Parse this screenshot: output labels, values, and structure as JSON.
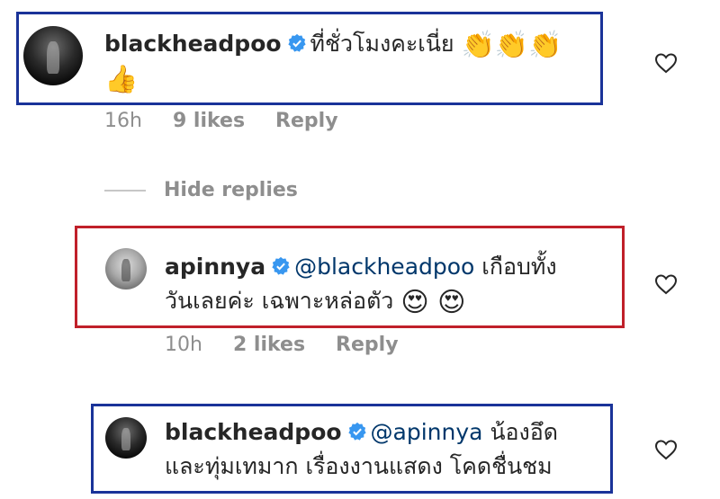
{
  "colors": {
    "frame_blue": "#1a3399",
    "frame_red": "#c0202a",
    "verified": "#3897f0",
    "mention": "#00376b",
    "meta": "#8e8e8e"
  },
  "comments": [
    {
      "username": "blackheadpoo",
      "text": "ที่ชั่วโมงคะเนี่ย",
      "emojis_line1": "👏👏👏",
      "emojis_line2": "👍",
      "time": "16h",
      "likes": "9 likes",
      "reply": "Reply"
    },
    {
      "username": "apinnya",
      "mention": "@blackheadpoo",
      "text_line1": "เกือบทั้ง",
      "text_line2": "วันเลยค่ะ เฉพาะหล่อตัว",
      "emojis": "😍 😍",
      "time": "10h",
      "likes": "2 likes",
      "reply": "Reply"
    },
    {
      "username": "blackheadpoo",
      "mention": "@apinnya",
      "text_line1": "น้องอึด",
      "text_line2": "และทุ่มเทมาก เรื่องงานแสดง โคดชื่นชม"
    }
  ],
  "thread": {
    "hide_replies": "Hide replies"
  },
  "icons": [
    "verified-badge-icon",
    "heart-icon",
    "avatar"
  ]
}
